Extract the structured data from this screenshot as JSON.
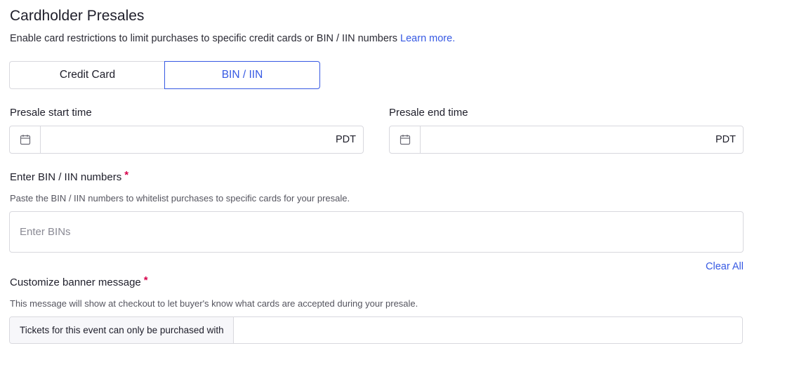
{
  "title": "Cardholder Presales",
  "subtitle": {
    "text": "Enable card restrictions to limit purchases to specific credit cards or BIN / IIN numbers",
    "link": "Learn more."
  },
  "tabs": [
    {
      "label": "Credit Card",
      "active": false
    },
    {
      "label": "BIN / IIN",
      "active": true
    }
  ],
  "presale_start": {
    "label": "Presale start time",
    "value": "",
    "timezone": "PDT",
    "icon": "calendar-icon"
  },
  "presale_end": {
    "label": "Presale end time",
    "value": "",
    "timezone": "PDT",
    "icon": "calendar-icon"
  },
  "bins": {
    "label": "Enter BIN / IIN numbers",
    "required_mark": "*",
    "helper": "Paste the BIN / IIN numbers to whitelist purchases to specific cards for your presale.",
    "placeholder": "Enter BINs",
    "value": "",
    "clear_label": "Clear All"
  },
  "banner": {
    "label": "Customize banner message",
    "required_mark": "*",
    "helper": "This message will show at checkout to let buyer's know what cards are accepted during your presale.",
    "prefix": "Tickets for this event can only be purchased with",
    "value": ""
  },
  "colors": {
    "accent": "#3659e3",
    "required": "#d6004b",
    "border": "#d8d8de"
  }
}
